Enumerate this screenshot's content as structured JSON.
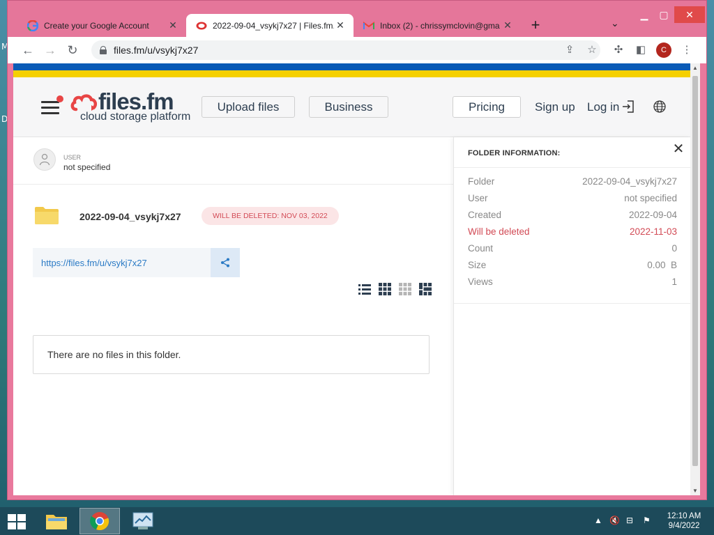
{
  "desktop": {
    "letters": [
      "M",
      "D"
    ]
  },
  "browser": {
    "tabs": [
      {
        "title": "Create your Google Account",
        "favicon": "google-g-icon"
      },
      {
        "title": "2022-09-04_vsykj7x27 | Files.fm.",
        "favicon": "filesfm-icon"
      },
      {
        "title": "Inbox (2) - chrissymclovin@gma",
        "favicon": "gmail-icon"
      }
    ],
    "new_tab": "+",
    "url": "files.fm/u/vsykj7x27",
    "profile_initial": "C"
  },
  "site": {
    "logo_text": "files.fm",
    "logo_sub": "cloud storage platform",
    "nav": {
      "upload": "Upload files",
      "business": "Business",
      "pricing": "Pricing",
      "signup": "Sign up",
      "login": "Log in"
    },
    "user": {
      "label": "USER",
      "value": "not specified"
    },
    "folder": {
      "name": "2022-09-04_vsykj7x27",
      "delete_badge": "WILL BE DELETED: NOV 03, 2022",
      "link": "https://files.fm/u/vsykj7x27"
    },
    "empty_message": "There are no files in this folder."
  },
  "panel": {
    "title": "FOLDER INFORMATION:",
    "rows": [
      {
        "label": "Folder",
        "value": "2022-09-04_vsykj7x27"
      },
      {
        "label": "User",
        "value": "not specified"
      },
      {
        "label": "Created",
        "value": "2022-09-04"
      },
      {
        "label": "Will be deleted",
        "value": "2022-11-03"
      },
      {
        "label": "Count",
        "value": "0"
      },
      {
        "label": "Size",
        "value": "0.00  B"
      },
      {
        "label": "Views",
        "value": "1"
      }
    ]
  },
  "taskbar": {
    "time": "12:10 AM",
    "date": "9/4/2022"
  },
  "colors": {
    "window_frame": "#e9799d",
    "warn": "#d24a55",
    "link": "#2a7ac5",
    "brand_red": "#e84545",
    "brand_dark": "#2d3e50"
  }
}
